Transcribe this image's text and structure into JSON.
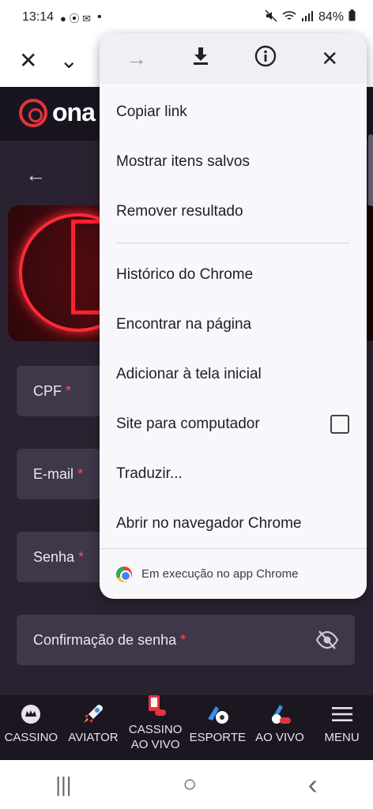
{
  "status": {
    "time": "13:14",
    "notif_icons": "● ⦿ ✉",
    "dot": "•",
    "battery": "84%"
  },
  "toolbar": {
    "close_symbol": "✕",
    "collapse_symbol": "⌄"
  },
  "site": {
    "logo_text": "ona",
    "back_symbol": "←",
    "fields": [
      {
        "label": "CPF",
        "required": "*"
      },
      {
        "label": "E-mail",
        "required": "*"
      },
      {
        "label": "Senha",
        "required": "*"
      },
      {
        "label": "Confirmação de senha",
        "required": "*"
      }
    ],
    "nav": [
      {
        "label": "CASSINO",
        "icon": "crown-icon"
      },
      {
        "label": "AVIATOR",
        "icon": "rocket-icon"
      },
      {
        "label": "CASSINO AO VIVO",
        "icon": "live-casino-icon"
      },
      {
        "label": "ESPORTE",
        "icon": "football-icon"
      },
      {
        "label": "AO VIVO",
        "icon": "live-icon"
      },
      {
        "label": "MENU",
        "icon": "hamburger-icon"
      }
    ]
  },
  "menu": {
    "top_icons": [
      "forward-icon",
      "download-icon",
      "info-icon",
      "close-icon"
    ],
    "top_symbols": [
      "→",
      "⤓",
      "ⓘ",
      "✕"
    ],
    "items": [
      "Copiar link",
      "Mostrar itens salvos",
      "Remover resultado",
      "Histórico do Chrome",
      "Encontrar na página",
      "Adicionar à tela inicial",
      "Site para computador",
      "Traduzir...",
      "Abrir no navegador Chrome"
    ],
    "footer": "Em execução no app Chrome"
  },
  "sysnav": {
    "recents": "|||",
    "home": "○",
    "back": "‹"
  },
  "colors": {
    "accent_red": "#e5343b",
    "page_bg": "#2a2230",
    "field_bg": "#3f374a"
  }
}
